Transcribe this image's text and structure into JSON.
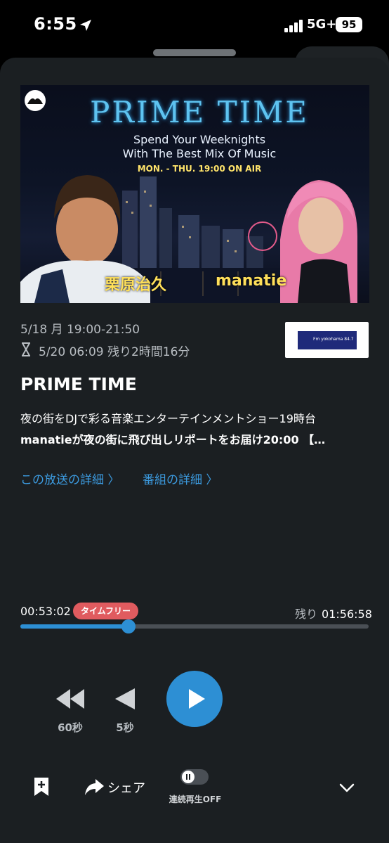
{
  "status_bar": {
    "time": "6:55",
    "network": "5G+",
    "battery": "95"
  },
  "banner": {
    "title": "PRIME TIME",
    "subtitle_1": "Spend Your Weeknights",
    "subtitle_2": "With The Best Mix Of Music",
    "on_air": "MON. - THU. 19:00 ON AIR",
    "host_left": "栗原治久",
    "host_right": "manatie"
  },
  "program": {
    "date": "5/18 月 19:00-21:50",
    "expiry": "5/20 06:09  残り2時間16分",
    "station_logo_text": "Fm yokohama 84.7",
    "title": "PRIME TIME",
    "description_1": " 夜の街をDJで彩る音楽エンターテインメントショー19時台",
    "description_2": "manatieが夜の街に飛び出しリポートをお届け20:00 【…"
  },
  "links": {
    "broadcast_detail": "この放送の詳細  〉",
    "program_detail": "番組の詳細  〉"
  },
  "player": {
    "elapsed": "00:53:02",
    "badge": "タイムフリー",
    "remaining_label": "残り",
    "remaining": "01:56:58",
    "progress": 0.31,
    "rewind_60_label": "60秒",
    "rewind_5_label": "5秒"
  },
  "bottom_bar": {
    "share_label": "シェア",
    "continuous_label": "連続再生OFF"
  },
  "colors": {
    "accent": "#2d8fd4",
    "badge": "#e05b5f",
    "sheet": "#1b1f22"
  }
}
